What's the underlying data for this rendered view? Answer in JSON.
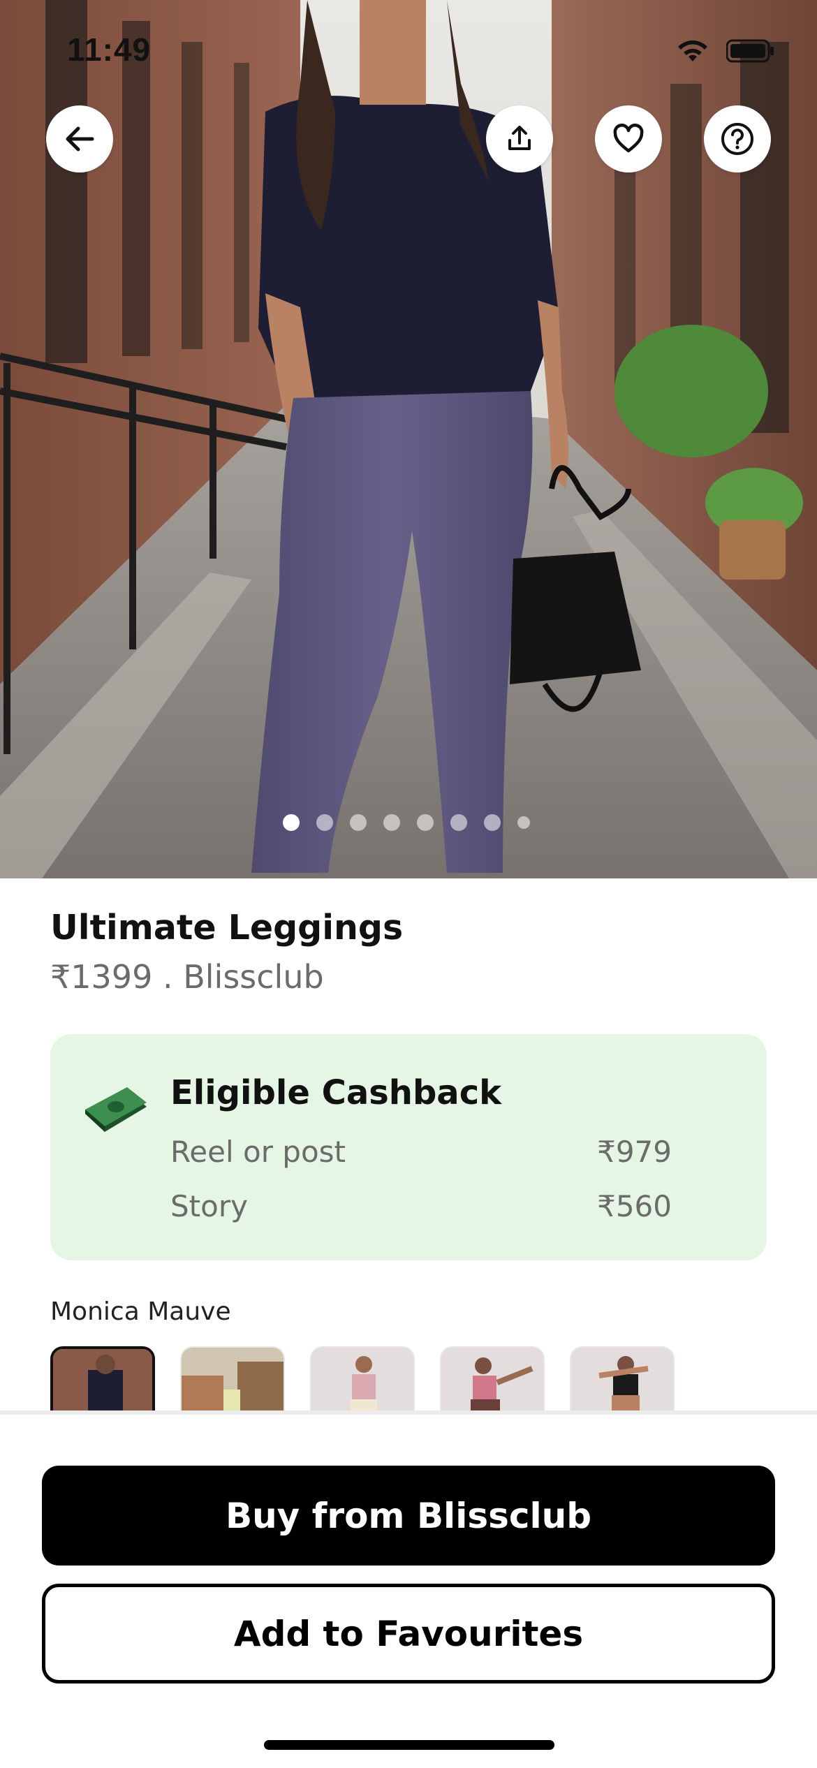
{
  "status_bar": {
    "time": "11:49",
    "icons": [
      "wifi-icon",
      "battery-icon"
    ]
  },
  "top_actions": {
    "back": "arrow-left-icon",
    "share": "share-icon",
    "favourite": "heart-icon",
    "help": "help-icon"
  },
  "carousel": {
    "total": 8,
    "active_index": 0
  },
  "product": {
    "name": "Ultimate Leggings",
    "price_brand": "₹1399 . Blissclub"
  },
  "cashback": {
    "title": "Eligible Cashback",
    "icon": "cash-icon",
    "rows": [
      {
        "label": "Reel or post",
        "amount": "₹979"
      },
      {
        "label": "Story",
        "amount": "₹560"
      }
    ]
  },
  "variant": {
    "label": "Monica Mauve",
    "thumbnail_count": 5,
    "selected_index": 0
  },
  "actions": {
    "buy_label": "Buy from Blissclub",
    "favourite_label": "Add to Favourites"
  },
  "colors": {
    "cashback_bg": "#e5f6e5",
    "primary_button": "#000000",
    "price_text": "#6b6b6b"
  }
}
